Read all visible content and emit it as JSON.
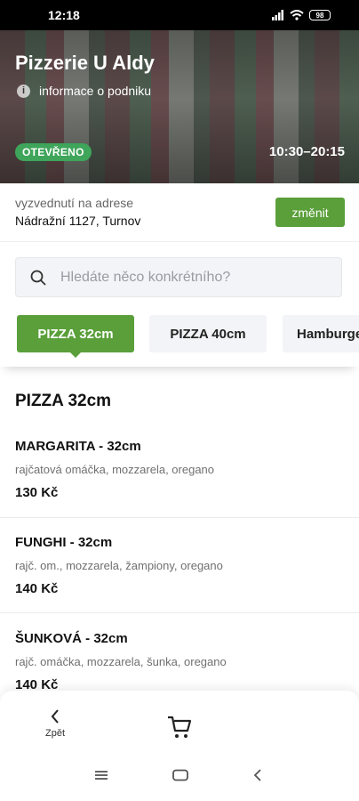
{
  "status": {
    "time": "12:18",
    "battery": "98"
  },
  "restaurant": {
    "name": "Pizzerie U Aldy",
    "info_label": "informace o podniku",
    "status_badge": "OTEVŘENO",
    "hours": "10:30–20:15",
    "colors": {
      "accent": "#5a9f3a",
      "badge": "#3ea55a"
    }
  },
  "address": {
    "caption": "vyzvednutí na adrese",
    "value": "Nádražní 1127, Turnov",
    "change_label": "změnit"
  },
  "search": {
    "placeholder": "Hledáte něco konkrétního?",
    "icon": "search-icon"
  },
  "tabs": [
    {
      "label": "PIZZA 32cm",
      "active": true
    },
    {
      "label": "PIZZA 40cm",
      "active": false
    },
    {
      "label": "Hamburgery",
      "active": false
    }
  ],
  "section": {
    "title": "PIZZA 32cm"
  },
  "items": [
    {
      "name": "MARGARITA - 32cm",
      "description": "rajčatová omáčka, mozzarela, oregano",
      "price": "130 Kč"
    },
    {
      "name": "FUNGHI - 32cm",
      "description": "rajč. om., mozzarela, žampiony, oregano",
      "price": "140 Kč"
    },
    {
      "name": "ŠUNKOVÁ - 32cm",
      "description": "rajč. omáčka, mozzarela, šunka, oregano",
      "price": "140 Kč"
    }
  ],
  "bottom_bar": {
    "back_label": "Zpět",
    "icons": [
      "chevron-left-icon",
      "cart-icon"
    ]
  },
  "system_nav": {
    "icons": [
      "menu-icon",
      "home-icon",
      "back-icon"
    ]
  }
}
